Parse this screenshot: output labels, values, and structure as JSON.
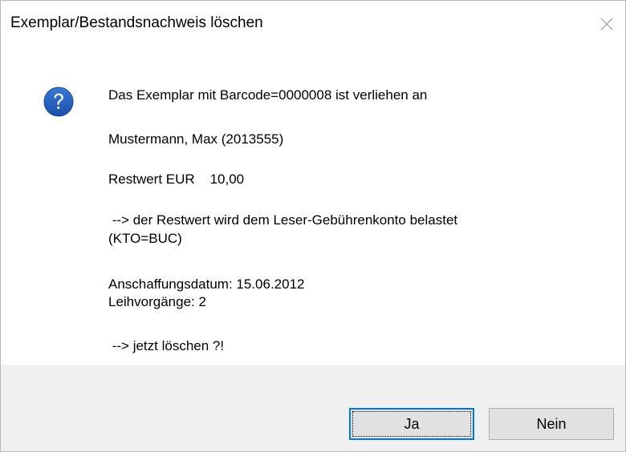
{
  "window": {
    "title": "Exemplar/Bestandsnachweis löschen"
  },
  "icons": {
    "dialog_icon": "question-icon",
    "close": "close-icon"
  },
  "colors": {
    "icon_blue": "#1f5fbf",
    "default_button_border": "#0078d7",
    "footer_bg": "#f0f0f0"
  },
  "message": {
    "line_barcode": "Das Exemplar mit Barcode=0000008 ist verliehen an",
    "line_reader": "Mustermann, Max (2013555)",
    "line_restwert": "Restwert EUR    10,00",
    "line_belastung": " --> der Restwert wird dem Leser-Gebührenkonto belastet",
    "line_konto": "(KTO=BUC)",
    "line_datum": "Anschaffungsdatum: 15.06.2012",
    "line_leihvorgaenge": "Leihvorgänge: 2",
    "line_question": " --> jetzt löschen ?!"
  },
  "buttons": {
    "yes_label": "Ja",
    "no_label": "Nein"
  }
}
